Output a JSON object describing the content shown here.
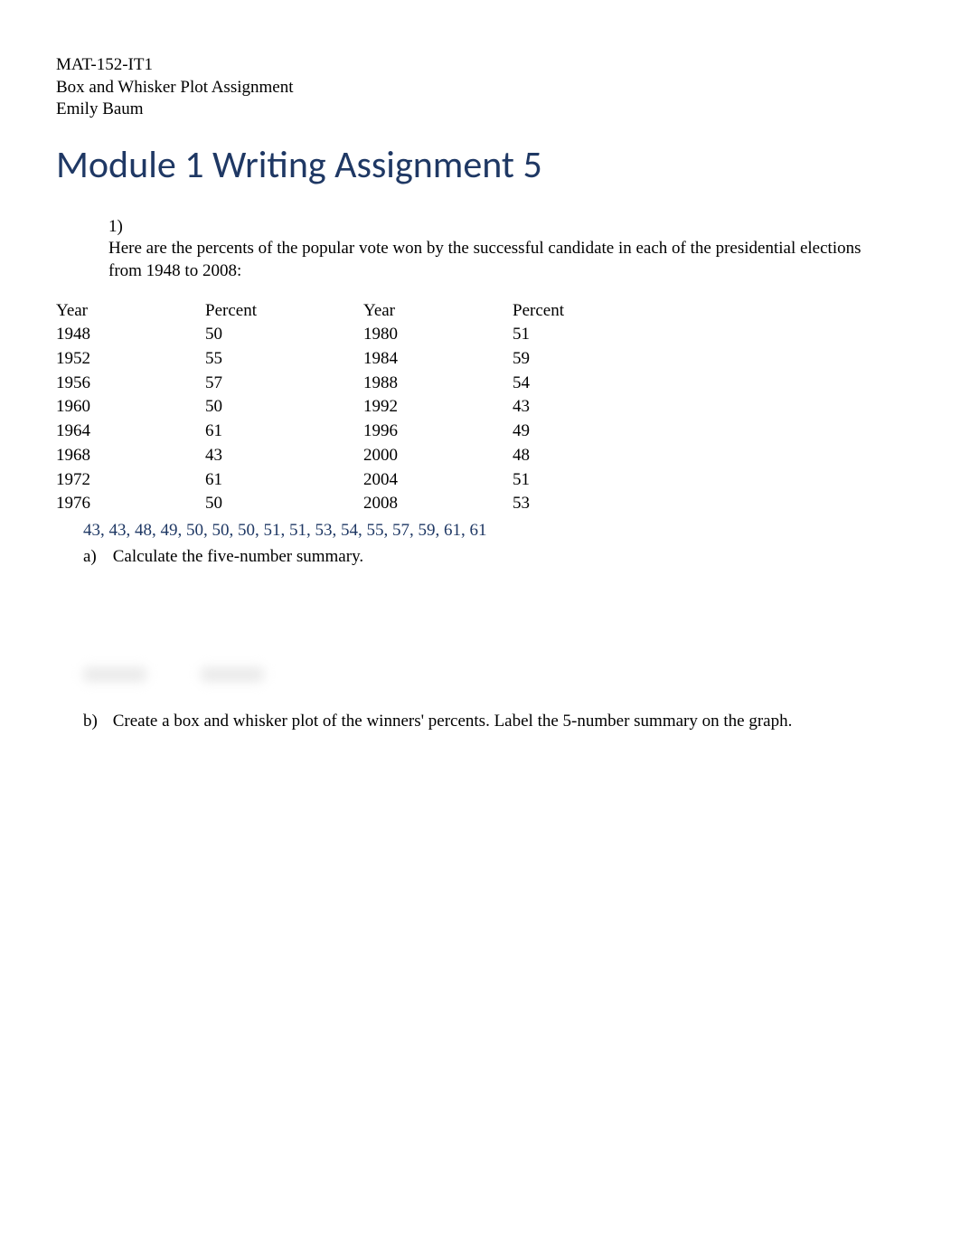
{
  "header": {
    "course": "MAT-152-IT1",
    "assignment": "Box and Whisker Plot Assignment",
    "student": "Emily Baum"
  },
  "title": "Module 1 Writing Assignment 5",
  "question": {
    "number": "1)",
    "text": "Here are the percents of the popular vote won by the successful candidate in each of the presidential elections from 1948 to 2008:"
  },
  "table": {
    "headers": {
      "year": "Year",
      "percent": "Percent"
    },
    "rows": [
      {
        "yearL": "1948",
        "pctL": "50",
        "yearR": "1980",
        "pctR": "51"
      },
      {
        "yearL": "1952",
        "pctL": "55",
        "yearR": "1984",
        "pctR": "59"
      },
      {
        "yearL": "1956",
        "pctL": "57",
        "yearR": "1988",
        "pctR": "54"
      },
      {
        "yearL": "1960",
        "pctL": "50",
        "yearR": "1992",
        "pctR": "43"
      },
      {
        "yearL": "1964",
        "pctL": "61",
        "yearR": "1996",
        "pctR": "49"
      },
      {
        "yearL": "1968",
        "pctL": "43",
        "yearR": "2000",
        "pctR": "48"
      },
      {
        "yearL": "1972",
        "pctL": "61",
        "yearR": "2004",
        "pctR": "51"
      },
      {
        "yearL": "1976",
        "pctL": "50",
        "yearR": "2008",
        "pctR": "53"
      }
    ]
  },
  "sorted_data": "43, 43, 48, 49, 50, 50, 50, 51, 51, 53, 54, 55, 57, 59, 61, 61",
  "sub_a": {
    "letter": "a)",
    "text": "Calculate the five-number summary."
  },
  "sub_b": {
    "letter": "b)",
    "text": "Create a box and whisker plot of the winners' percents. Label the 5-number summary on the graph."
  }
}
